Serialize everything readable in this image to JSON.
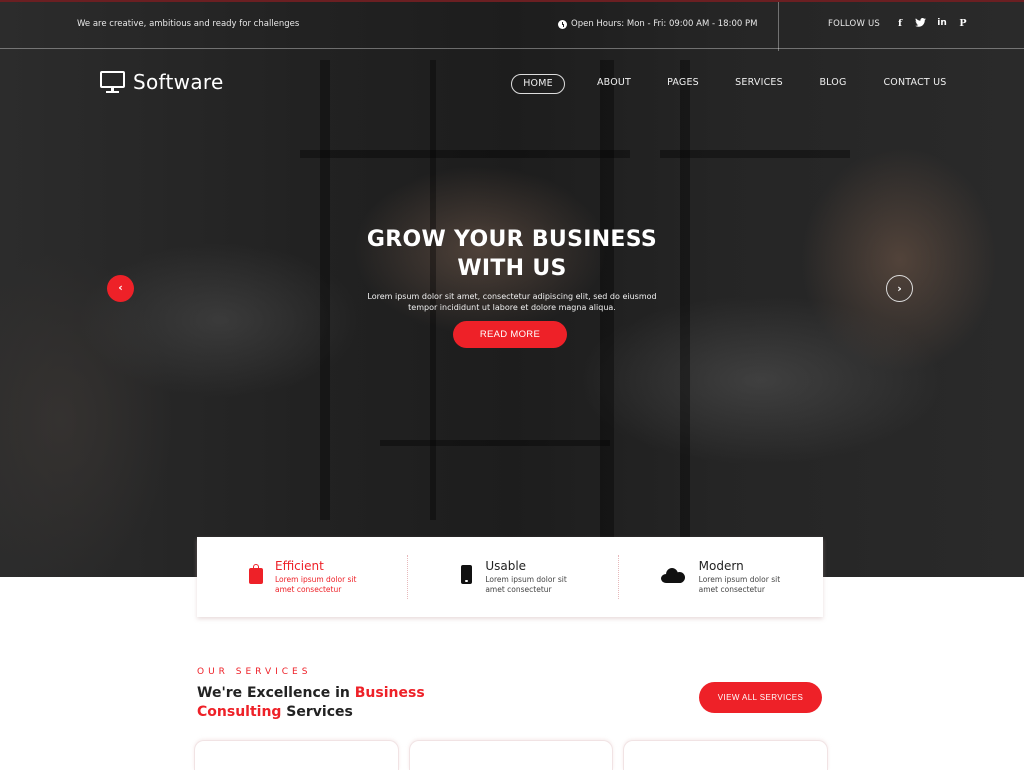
{
  "topbar": {
    "tagline": "We are creative, ambitious and ready for challenges",
    "hours_icon": "clock-icon",
    "hours": "Open Hours: Mon - Fri: 09:00 AM - 18:00 PM",
    "follow_label": "FOLLOW US",
    "social": [
      {
        "icon": "facebook-icon",
        "glyph": "f"
      },
      {
        "icon": "twitter-icon",
        "glyph": "🐦"
      },
      {
        "icon": "linkedin-icon",
        "glyph": "in"
      },
      {
        "icon": "pinterest-icon",
        "glyph": "P"
      }
    ]
  },
  "header": {
    "logo_icon": "monitor-icon",
    "brand": "Software",
    "nav": [
      {
        "label": "HOME",
        "active": true
      },
      {
        "label": "ABOUT",
        "active": false
      },
      {
        "label": "PAGES",
        "active": false
      },
      {
        "label": "SERVICES",
        "active": false
      },
      {
        "label": "BLOG",
        "active": false
      },
      {
        "label": "CONTACT US",
        "active": false
      }
    ]
  },
  "hero": {
    "title_line1": "GROW YOUR BUSINESS",
    "title_line2": "WITH US",
    "text": "Lorem ipsum dolor sit amet, consectetur adipiscing elit, sed do eiusmod tempor incididunt ut labore et dolore magna aliqua.",
    "cta": "READ MORE",
    "prev_glyph": "‹",
    "next_glyph": "›"
  },
  "features": [
    {
      "icon": "shopping-bag-icon",
      "title": "Efficient",
      "text": "Lorem ipsum dolor sit amet consectetur"
    },
    {
      "icon": "mobile-phone-icon",
      "title": "Usable",
      "text": "Lorem ipsum dolor sit amet consectetur"
    },
    {
      "icon": "cloud-icon",
      "title": "Modern",
      "text": "Lorem ipsum dolor sit amet consectetur"
    }
  ],
  "services": {
    "kicker": "OUR SERVICES",
    "heading_part1": "We're Excellence in ",
    "heading_red1": "Business",
    "heading_red2": "Consulting",
    "heading_part2": " Services",
    "button": "VIEW ALL SERVICES"
  },
  "colors": {
    "accent": "#ee2128",
    "dark_text": "#222222",
    "white": "#ffffff"
  }
}
